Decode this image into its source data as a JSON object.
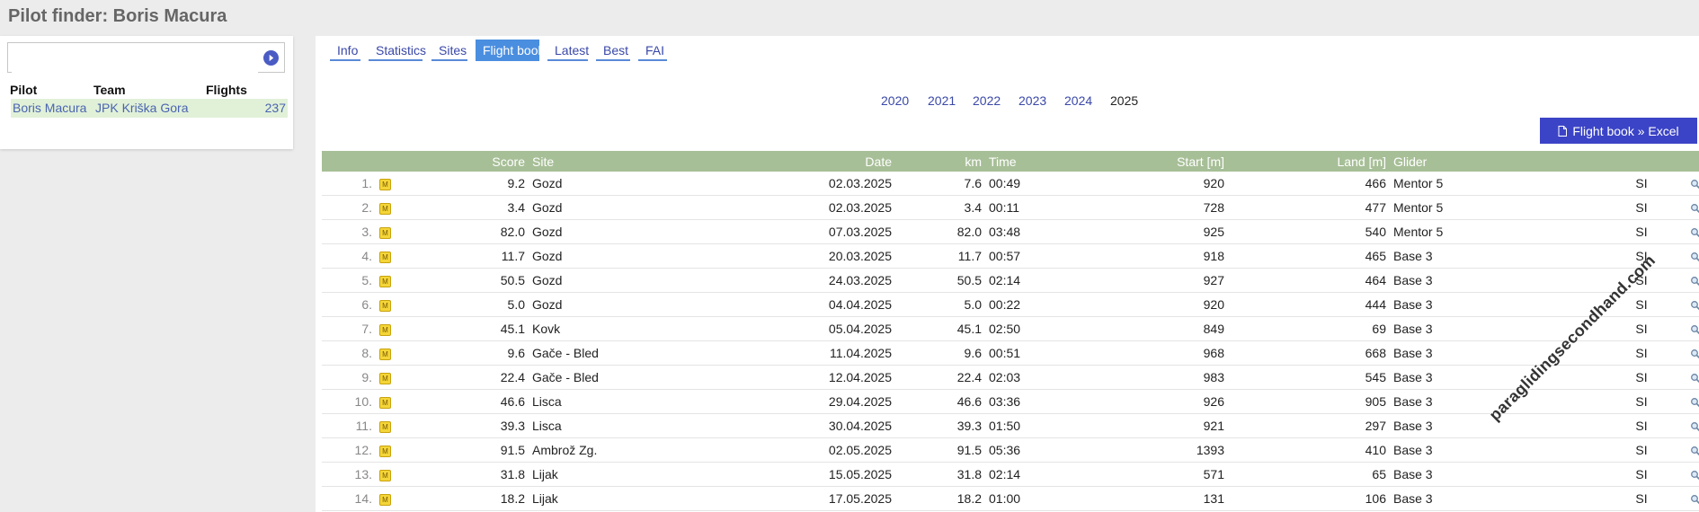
{
  "page": {
    "title": "Pilot finder: Boris Macura"
  },
  "search": {
    "placeholder": ""
  },
  "pilot_table": {
    "headers": {
      "pilot": "Pilot",
      "team": "Team",
      "flights": "Flights"
    },
    "row": {
      "pilot": "Boris Macura",
      "team": "JPK Kriška Gora",
      "flights": "237"
    }
  },
  "tabs": [
    "Info",
    "Statistics",
    "Sites",
    "Flight book",
    "Latest",
    "Best",
    "FAI"
  ],
  "active_tab": "Flight book",
  "years": [
    "2020",
    "2021",
    "2022",
    "2023",
    "2024",
    "2025"
  ],
  "current_year": "2025",
  "excel_button": {
    "label": "Flight book » Excel"
  },
  "flight_table": {
    "headers": {
      "score": "Score",
      "site": "Site",
      "date": "Date",
      "km": "km",
      "time": "Time",
      "start": "Start [m]",
      "land": "Land [m]",
      "glider": "Glider"
    },
    "rows": [
      {
        "num": "1.",
        "score": "9.2",
        "site": "Gozd",
        "date": "02.03.2025",
        "km": "7.6",
        "time": "00:49",
        "start": "920",
        "land": "466",
        "glider": "Mentor 5",
        "country": "SI"
      },
      {
        "num": "2.",
        "score": "3.4",
        "site": "Gozd",
        "date": "02.03.2025",
        "km": "3.4",
        "time": "00:11",
        "start": "728",
        "land": "477",
        "glider": "Mentor 5",
        "country": "SI"
      },
      {
        "num": "3.",
        "score": "82.0",
        "site": "Gozd",
        "date": "07.03.2025",
        "km": "82.0",
        "time": "03:48",
        "start": "925",
        "land": "540",
        "glider": "Mentor 5",
        "country": "SI"
      },
      {
        "num": "4.",
        "score": "11.7",
        "site": "Gozd",
        "date": "20.03.2025",
        "km": "11.7",
        "time": "00:57",
        "start": "918",
        "land": "465",
        "glider": "Base 3",
        "country": "SI"
      },
      {
        "num": "5.",
        "score": "50.5",
        "site": "Gozd",
        "date": "24.03.2025",
        "km": "50.5",
        "time": "02:14",
        "start": "927",
        "land": "464",
        "glider": "Base 3",
        "country": "SI"
      },
      {
        "num": "6.",
        "score": "5.0",
        "site": "Gozd",
        "date": "04.04.2025",
        "km": "5.0",
        "time": "00:22",
        "start": "920",
        "land": "444",
        "glider": "Base 3",
        "country": "SI"
      },
      {
        "num": "7.",
        "score": "45.1",
        "site": "Kovk",
        "date": "05.04.2025",
        "km": "45.1",
        "time": "02:50",
        "start": "849",
        "land": "69",
        "glider": "Base 3",
        "country": "SI"
      },
      {
        "num": "8.",
        "score": "9.6",
        "site": "Gače - Bled",
        "date": "11.04.2025",
        "km": "9.6",
        "time": "00:51",
        "start": "968",
        "land": "668",
        "glider": "Base 3",
        "country": "SI"
      },
      {
        "num": "9.",
        "score": "22.4",
        "site": "Gače - Bled",
        "date": "12.04.2025",
        "km": "22.4",
        "time": "02:03",
        "start": "983",
        "land": "545",
        "glider": "Base 3",
        "country": "SI"
      },
      {
        "num": "10.",
        "score": "46.6",
        "site": "Lisca",
        "date": "29.04.2025",
        "km": "46.6",
        "time": "03:36",
        "start": "926",
        "land": "905",
        "glider": "Base 3",
        "country": "SI"
      },
      {
        "num": "11.",
        "score": "39.3",
        "site": "Lisca",
        "date": "30.04.2025",
        "km": "39.3",
        "time": "01:50",
        "start": "921",
        "land": "297",
        "glider": "Base 3",
        "country": "SI"
      },
      {
        "num": "12.",
        "score": "91.5",
        "site": "Ambrož Zg.",
        "date": "02.05.2025",
        "km": "91.5",
        "time": "05:36",
        "start": "1393",
        "land": "410",
        "glider": "Base 3",
        "country": "SI"
      },
      {
        "num": "13.",
        "score": "31.8",
        "site": "Lijak",
        "date": "15.05.2025",
        "km": "31.8",
        "time": "02:14",
        "start": "571",
        "land": "65",
        "glider": "Base 3",
        "country": "SI"
      },
      {
        "num": "14.",
        "score": "18.2",
        "site": "Lijak",
        "date": "17.05.2025",
        "km": "18.2",
        "time": "01:00",
        "start": "131",
        "land": "106",
        "glider": "Base 3",
        "country": "SI"
      }
    ]
  },
  "watermark": "paraglidingsecondhand.com",
  "colors": {
    "header_bg": "#a7bf97",
    "accent": "#3b44c6",
    "active_tab": "#4a8ee0",
    "link": "#3a48a8"
  }
}
